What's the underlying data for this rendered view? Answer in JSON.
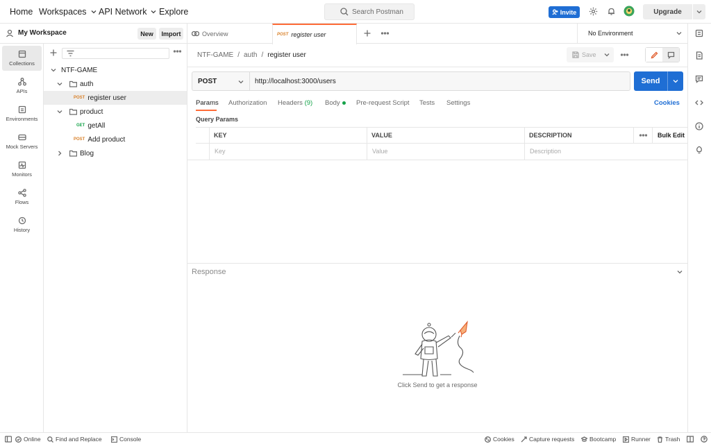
{
  "topbar": {
    "home": "Home",
    "workspaces": "Workspaces",
    "api_network": "API Network",
    "explore": "Explore",
    "search_placeholder": "Search Postman",
    "invite": "Invite",
    "upgrade": "Upgrade"
  },
  "workspace": {
    "name": "My Workspace",
    "new_label": "New",
    "import_label": "Import"
  },
  "rail": {
    "items": [
      {
        "label": "Collections",
        "icon": "collections-icon",
        "active": true
      },
      {
        "label": "APIs",
        "icon": "apis-icon"
      },
      {
        "label": "Environments",
        "icon": "environments-icon"
      },
      {
        "label": "Mock Servers",
        "icon": "mock-servers-icon"
      },
      {
        "label": "Monitors",
        "icon": "monitors-icon"
      },
      {
        "label": "Flows",
        "icon": "flows-icon"
      },
      {
        "label": "History",
        "icon": "history-icon"
      }
    ]
  },
  "tree": {
    "collection": "NTF-GAME",
    "folders": [
      {
        "name": "auth",
        "expanded": true,
        "requests": [
          {
            "method": "POST",
            "name": "register user",
            "selected": true
          }
        ]
      },
      {
        "name": "product",
        "expanded": true,
        "requests": [
          {
            "method": "GET",
            "name": "getAll"
          },
          {
            "method": "POST",
            "name": "Add product"
          }
        ]
      },
      {
        "name": "Blog",
        "expanded": false,
        "requests": []
      }
    ]
  },
  "tabs": {
    "overview": "Overview",
    "active_method": "POST",
    "active_name": "register user"
  },
  "environment": "No Environment",
  "breadcrumb": {
    "collection": "NTF-GAME",
    "folder": "auth",
    "current": "register user",
    "sep": "/"
  },
  "save_label": "Save",
  "request": {
    "method": "POST",
    "url": "http://localhost:3000/users",
    "send_label": "Send"
  },
  "request_tabs": {
    "params": "Params",
    "authorization": "Authorization",
    "headers": "Headers",
    "headers_count": "(9)",
    "body": "Body",
    "prerequest": "Pre-request Script",
    "tests": "Tests",
    "settings": "Settings",
    "cookies": "Cookies"
  },
  "params": {
    "section_label": "Query Params",
    "columns": [
      "KEY",
      "VALUE",
      "DESCRIPTION"
    ],
    "bulk_edit": "Bulk Edit",
    "placeholders": [
      "Key",
      "Value",
      "Description"
    ]
  },
  "response": {
    "label": "Response",
    "hint": "Click Send to get a response"
  },
  "statusbar": {
    "online": "Online",
    "find_replace": "Find and Replace",
    "console": "Console",
    "cookies": "Cookies",
    "capture": "Capture requests",
    "bootcamp": "Bootcamp",
    "runner": "Runner",
    "trash": "Trash"
  },
  "colors": {
    "accent": "#ff6c37",
    "primary": "#1f6ed4",
    "post": "#d9822b",
    "get": "#16a34a"
  }
}
